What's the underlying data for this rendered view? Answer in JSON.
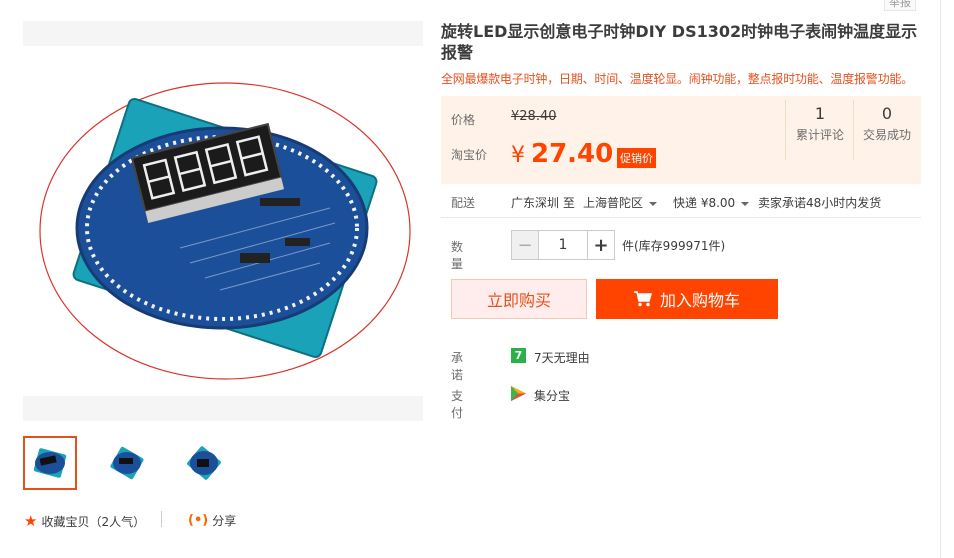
{
  "report_label": "举报",
  "product": {
    "title": "旋转LED显示创意电子时钟DIY DS1302时钟电子表闹钟温度显示报警",
    "subtitle": "全网最爆款电子时钟，日期、时间、温度轮显。闹钟功能，整点报时功能、温度报警功能。"
  },
  "price": {
    "orig_label": "价格",
    "orig_value": "¥28.40",
    "taobao_label": "淘宝价",
    "symbol": "¥",
    "current": "27.40",
    "promo_tag": "促销价"
  },
  "stats": [
    {
      "num": "1",
      "caption": "累计评论"
    },
    {
      "num": "0",
      "caption": "交易成功"
    }
  ],
  "shipping": {
    "label": "配送",
    "from": "广东深圳 至",
    "to": "上海普陀区",
    "method": "快递 ¥8.00",
    "promise": "卖家承诺48小时内发货"
  },
  "quantity": {
    "label": "数量",
    "value": "1",
    "minus": "−",
    "plus": "+",
    "stock": "件(库存999971件)"
  },
  "actions": {
    "buy_now": "立即购买",
    "add_cart": "加入购物车"
  },
  "guarantee": {
    "label": "承诺",
    "icon_text": "7",
    "text": "7天无理由"
  },
  "payment": {
    "label": "支付",
    "text": "集分宝"
  },
  "favorite": {
    "text": "收藏宝贝（2人气）"
  },
  "share": {
    "text": "分享"
  },
  "colors": {
    "accent": "#ff4400",
    "price_bg": "#fff2e8",
    "guarantee_green": "#2bb14a"
  }
}
